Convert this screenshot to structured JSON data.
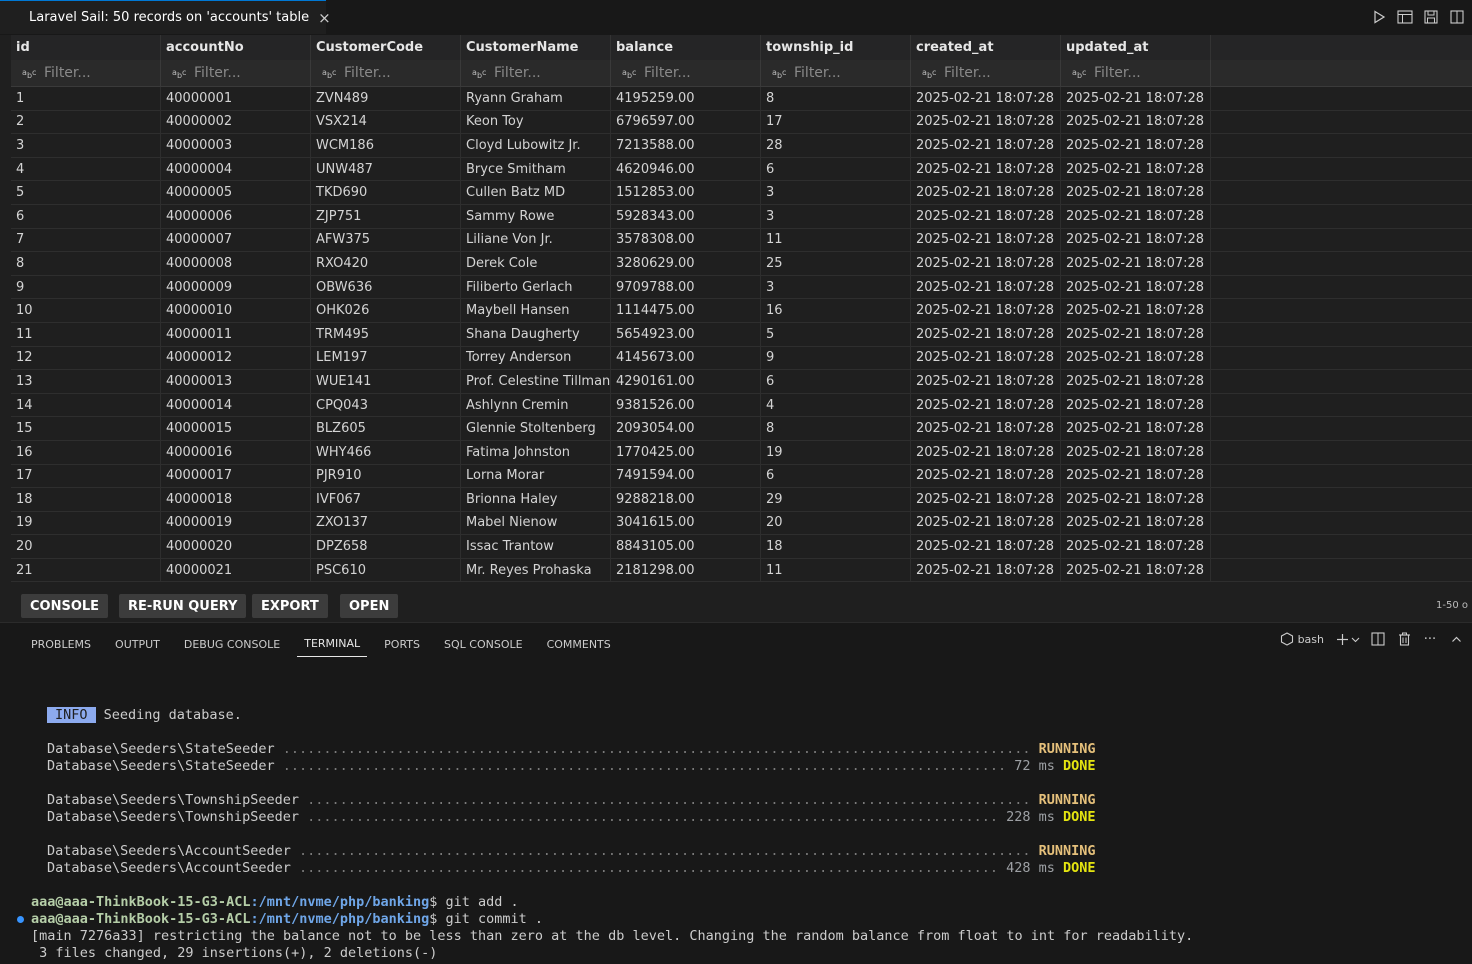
{
  "tab": {
    "title": "Laravel Sail: 50 records on 'accounts' table",
    "close_glyph": "×"
  },
  "grid": {
    "columns": [
      "id",
      "accountNo",
      "CustomerCode",
      "CustomerName",
      "balance",
      "township_id",
      "created_at",
      "updated_at"
    ],
    "filter_placeholder": "Filter...",
    "rows": [
      [
        "1",
        "40000001",
        "ZVN489",
        "Ryann Graham",
        "4195259.00",
        "8",
        "2025-02-21 18:07:28",
        "2025-02-21 18:07:28"
      ],
      [
        "2",
        "40000002",
        "VSX214",
        "Keon Toy",
        "6796597.00",
        "17",
        "2025-02-21 18:07:28",
        "2025-02-21 18:07:28"
      ],
      [
        "3",
        "40000003",
        "WCM186",
        "Cloyd Lubowitz Jr.",
        "7213588.00",
        "28",
        "2025-02-21 18:07:28",
        "2025-02-21 18:07:28"
      ],
      [
        "4",
        "40000004",
        "UNW487",
        "Bryce Smitham",
        "4620946.00",
        "6",
        "2025-02-21 18:07:28",
        "2025-02-21 18:07:28"
      ],
      [
        "5",
        "40000005",
        "TKD690",
        "Cullen Batz MD",
        "1512853.00",
        "3",
        "2025-02-21 18:07:28",
        "2025-02-21 18:07:28"
      ],
      [
        "6",
        "40000006",
        "ZJP751",
        "Sammy Rowe",
        "5928343.00",
        "3",
        "2025-02-21 18:07:28",
        "2025-02-21 18:07:28"
      ],
      [
        "7",
        "40000007",
        "AFW375",
        "Liliane Von Jr.",
        "3578308.00",
        "11",
        "2025-02-21 18:07:28",
        "2025-02-21 18:07:28"
      ],
      [
        "8",
        "40000008",
        "RXO420",
        "Derek Cole",
        "3280629.00",
        "25",
        "2025-02-21 18:07:28",
        "2025-02-21 18:07:28"
      ],
      [
        "9",
        "40000009",
        "OBW636",
        "Filiberto Gerlach",
        "9709788.00",
        "3",
        "2025-02-21 18:07:28",
        "2025-02-21 18:07:28"
      ],
      [
        "10",
        "40000010",
        "OHK026",
        "Maybell Hansen",
        "1114475.00",
        "16",
        "2025-02-21 18:07:28",
        "2025-02-21 18:07:28"
      ],
      [
        "11",
        "40000011",
        "TRM495",
        "Shana Daugherty",
        "5654923.00",
        "5",
        "2025-02-21 18:07:28",
        "2025-02-21 18:07:28"
      ],
      [
        "12",
        "40000012",
        "LEM197",
        "Torrey Anderson",
        "4145673.00",
        "9",
        "2025-02-21 18:07:28",
        "2025-02-21 18:07:28"
      ],
      [
        "13",
        "40000013",
        "WUE141",
        "Prof. Celestine Tillman",
        "4290161.00",
        "6",
        "2025-02-21 18:07:28",
        "2025-02-21 18:07:28"
      ],
      [
        "14",
        "40000014",
        "CPQ043",
        "Ashlynn Cremin",
        "9381526.00",
        "4",
        "2025-02-21 18:07:28",
        "2025-02-21 18:07:28"
      ],
      [
        "15",
        "40000015",
        "BLZ605",
        "Glennie Stoltenberg",
        "2093054.00",
        "8",
        "2025-02-21 18:07:28",
        "2025-02-21 18:07:28"
      ],
      [
        "16",
        "40000016",
        "WHY466",
        "Fatima Johnston",
        "1770425.00",
        "19",
        "2025-02-21 18:07:28",
        "2025-02-21 18:07:28"
      ],
      [
        "17",
        "40000017",
        "PJR910",
        "Lorna Morar",
        "7491594.00",
        "6",
        "2025-02-21 18:07:28",
        "2025-02-21 18:07:28"
      ],
      [
        "18",
        "40000018",
        "IVF067",
        "Brionna Haley",
        "9288218.00",
        "29",
        "2025-02-21 18:07:28",
        "2025-02-21 18:07:28"
      ],
      [
        "19",
        "40000019",
        "ZXO137",
        "Mabel Nienow",
        "3041615.00",
        "20",
        "2025-02-21 18:07:28",
        "2025-02-21 18:07:28"
      ],
      [
        "20",
        "40000020",
        "DPZ658",
        "Issac Trantow",
        "8843105.00",
        "18",
        "2025-02-21 18:07:28",
        "2025-02-21 18:07:28"
      ],
      [
        "21",
        "40000021",
        "PSC610",
        "Mr. Reyes Prohaska",
        "2181298.00",
        "11",
        "2025-02-21 18:07:28",
        "2025-02-21 18:07:28"
      ]
    ]
  },
  "toolbar": {
    "buttons": [
      "CONSOLE",
      "RE-RUN QUERY",
      "EXPORT",
      "OPEN"
    ],
    "page_info": "1-50 o"
  },
  "panel": {
    "tabs": [
      "PROBLEMS",
      "OUTPUT",
      "DEBUG CONSOLE",
      "TERMINAL",
      "PORTS",
      "SQL CONSOLE",
      "COMMENTS"
    ],
    "active_tab": "TERMINAL",
    "shell_label": "bash",
    "more_glyph": "···"
  },
  "terminal": {
    "info_badge": "INFO",
    "info_text": "Seeding database.",
    "seeders": [
      {
        "name": "Database\\Seeders\\StateSeeder",
        "running_dots": " ............................................................................................ ",
        "done_dots": " ......................................................................................... ",
        "time": "72 ms",
        "running": "RUNNING",
        "done": "DONE"
      },
      {
        "name": "Database\\Seeders\\TownshipSeeder",
        "running_dots": " ......................................................................................... ",
        "done_dots": " ..................................................................................... ",
        "time": "228 ms",
        "running": "RUNNING",
        "done": "DONE"
      },
      {
        "name": "Database\\Seeders\\AccountSeeder",
        "running_dots": " .......................................................................................... ",
        "done_dots": " ...................................................................................... ",
        "time": "428 ms",
        "running": "RUNNING",
        "done": "DONE"
      }
    ],
    "prompt_user": "aaa@aaa-ThinkBook-15-G3-ACL",
    "prompt_path": ":/mnt/nvme/php/banking",
    "cmd1": "$ git add .",
    "cmd2": "$ git commit .",
    "commit_msg": "[main 7276a33] restricting the balance not to be less than zero at the db level. Changing the random balance from float to int for readability.",
    "commit_stats": " 3 files changed, 29 insertions(+), 2 deletions(-)"
  },
  "colors": {
    "accent": "#0078d4",
    "running": "#e5c07b",
    "done": "#e5e510",
    "info_badge_bg": "#8caaee",
    "prompt_user": "#b5cea8",
    "prompt_path": "#6fa6e8"
  },
  "icons": [
    "database-icon",
    "close-icon",
    "run-icon",
    "open-in-editor-icon",
    "save-icon",
    "split-editor-icon",
    "filter-text-icon",
    "terminal-profile-icon",
    "plus-icon",
    "chevron-down-icon",
    "split-terminal-icon",
    "trash-icon",
    "more-icon",
    "chevron-up-icon"
  ]
}
